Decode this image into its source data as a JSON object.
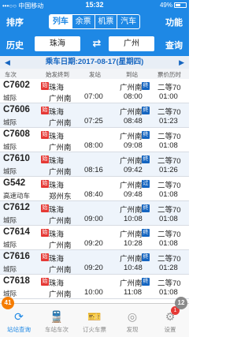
{
  "status": {
    "carrier": "•••○○ 中国移动",
    "wifi_icon": "wifi-icon",
    "time": "15:32",
    "battery": "49%"
  },
  "nav": {
    "left": "排序",
    "right": "功能",
    "tabs": [
      "列车",
      "余票",
      "机票",
      "汽车"
    ],
    "active_tab": "列车"
  },
  "search": {
    "history": "历史",
    "from": "珠海",
    "to": "广州",
    "query": "查询"
  },
  "date_bar": "乘车日期:2017-08-17(星期四)",
  "columns": [
    "车次",
    "始发终到",
    "发站",
    "到站",
    "票价历时"
  ],
  "trains": [
    {
      "code": "C7602",
      "type": "城际",
      "from": "珠海",
      "to": "广州南",
      "dep": "07:00",
      "arr_station": "广州南",
      "arr": "08:00",
      "seat": "二等70",
      "duration": "01:00",
      "start_badge": "始",
      "end_badge": "终"
    },
    {
      "code": "C7606",
      "type": "城际",
      "from": "珠海",
      "to": "广州南",
      "dep": "07:25",
      "arr_station": "广州南",
      "arr": "08:48",
      "seat": "二等70",
      "duration": "01:23",
      "start_badge": "始",
      "end_badge": "终"
    },
    {
      "code": "C7608",
      "type": "城际",
      "from": "珠海",
      "to": "广州南",
      "dep": "08:00",
      "arr_station": "广州南",
      "arr": "09:08",
      "seat": "二等70",
      "duration": "01:08",
      "start_badge": "始",
      "end_badge": "终"
    },
    {
      "code": "C7610",
      "type": "城际",
      "from": "珠海",
      "to": "广州南",
      "dep": "08:16",
      "arr_station": "广州南",
      "arr": "09:42",
      "seat": "二等70",
      "duration": "01:26",
      "start_badge": "始",
      "end_badge": "终"
    },
    {
      "code": "G542",
      "type": "高速动车",
      "from": "珠海",
      "to": "郑州东",
      "dep": "08:40",
      "arr_station": "广州南",
      "arr": "09:48",
      "seat": "二等70",
      "duration": "01:08",
      "start_badge": "始",
      "end_badge": "过"
    },
    {
      "code": "C7612",
      "type": "城际",
      "from": "珠海",
      "to": "广州南",
      "dep": "09:00",
      "arr_station": "广州南",
      "arr": "10:08",
      "seat": "二等70",
      "duration": "01:08",
      "start_badge": "始",
      "end_badge": "终"
    },
    {
      "code": "C7614",
      "type": "城际",
      "from": "珠海",
      "to": "广州南",
      "dep": "09:20",
      "arr_station": "广州南",
      "arr": "10:28",
      "seat": "二等70",
      "duration": "01:08",
      "start_badge": "始",
      "end_badge": "终"
    },
    {
      "code": "C7616",
      "type": "城际",
      "from": "珠海",
      "to": "广州南",
      "dep": "09:20",
      "arr_station": "广州南",
      "arr": "10:48",
      "seat": "二等70",
      "duration": "01:28",
      "start_badge": "始",
      "end_badge": "终"
    },
    {
      "code": "C7618",
      "type": "城际",
      "from": "珠海",
      "to": "广州南",
      "dep": "10:00",
      "arr_station": "广州南",
      "arr": "11:08",
      "seat": "二等70",
      "duration": "01:08",
      "start_badge": "始",
      "end_badge": "终"
    }
  ],
  "counter_left": "41",
  "counter_right": "12",
  "tabbar": [
    {
      "label": "站站查询",
      "icon": "refresh-icon"
    },
    {
      "label": "车站车次",
      "icon": "train-icon"
    },
    {
      "label": "订火车票",
      "icon": "ticket-icon"
    },
    {
      "label": "发现",
      "icon": "compass-icon"
    },
    {
      "label": "设置",
      "icon": "gear-icon",
      "badge": "1"
    }
  ],
  "colors": {
    "primary": "#1e88e5",
    "start_badge": "#e53935",
    "end_badge": "#1565c0",
    "counter_left": "#f57c00"
  }
}
